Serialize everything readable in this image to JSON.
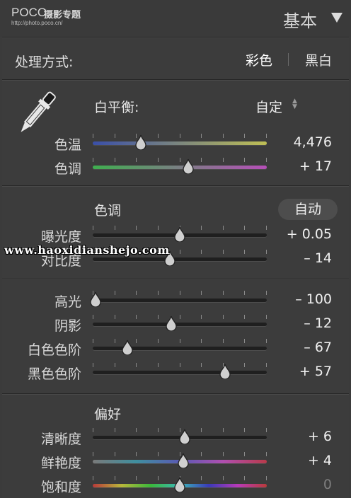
{
  "header": {
    "logo_main": "POCO",
    "logo_cn": "摄影专题",
    "logo_url": "http://photo.poco.cn/",
    "panel_title": "基本",
    "panel_toggle_icon": "triangle-down-icon"
  },
  "treatment": {
    "label": "处理方式:",
    "color_option": "彩色",
    "bw_option": "黑白"
  },
  "white_balance": {
    "eyedropper_icon": "eyedropper-icon",
    "title": "白平衡:",
    "preset": "自定",
    "temp": {
      "label": "色温",
      "value": "4,476",
      "position": 0.27
    },
    "tint": {
      "label": "色调",
      "value": "+ 17",
      "position": 0.55
    }
  },
  "tone": {
    "title": "色调",
    "auto_label": "自动",
    "exposure": {
      "label": "曝光度",
      "value": "+ 0.05",
      "position": 0.5
    },
    "contrast": {
      "label": "对比度",
      "value": "– 14",
      "position": 0.44
    },
    "highlights": {
      "label": "高光",
      "value": "– 100",
      "position": 0.0
    },
    "shadows": {
      "label": "阴影",
      "value": "– 12",
      "position": 0.45
    },
    "whites": {
      "label": "白色色阶",
      "value": "– 67",
      "position": 0.19
    },
    "blacks": {
      "label": "黑色色阶",
      "value": "+ 57",
      "position": 0.77
    }
  },
  "presence": {
    "title": "偏好",
    "clarity": {
      "label": "清晰度",
      "value": "+ 6",
      "position": 0.53
    },
    "vibrance": {
      "label": "鲜艳度",
      "value": "+ 4",
      "position": 0.52
    },
    "saturation": {
      "label": "饱和度",
      "value": "0",
      "position": 0.5
    }
  },
  "watermark": "www.haoxidianshejo.com",
  "colors": {
    "panel_bg": "#3c3c3c",
    "track": "#1f1f1f",
    "temp_gradient": [
      "#3a4fa8",
      "#bfbf55"
    ],
    "tint_gradient": [
      "#3fae4f",
      "#b64fb8"
    ],
    "vibrance_gradient": [
      "#7a7a7a",
      "#3f8f9f",
      "#5a5ab4",
      "#b04fb0",
      "#b83a4a"
    ],
    "saturation_gradient": [
      "#b83a3a",
      "#b8b83a",
      "#3ab83a",
      "#3ab8b8",
      "#3a3ab8",
      "#b83ab8",
      "#b83a3a"
    ]
  }
}
